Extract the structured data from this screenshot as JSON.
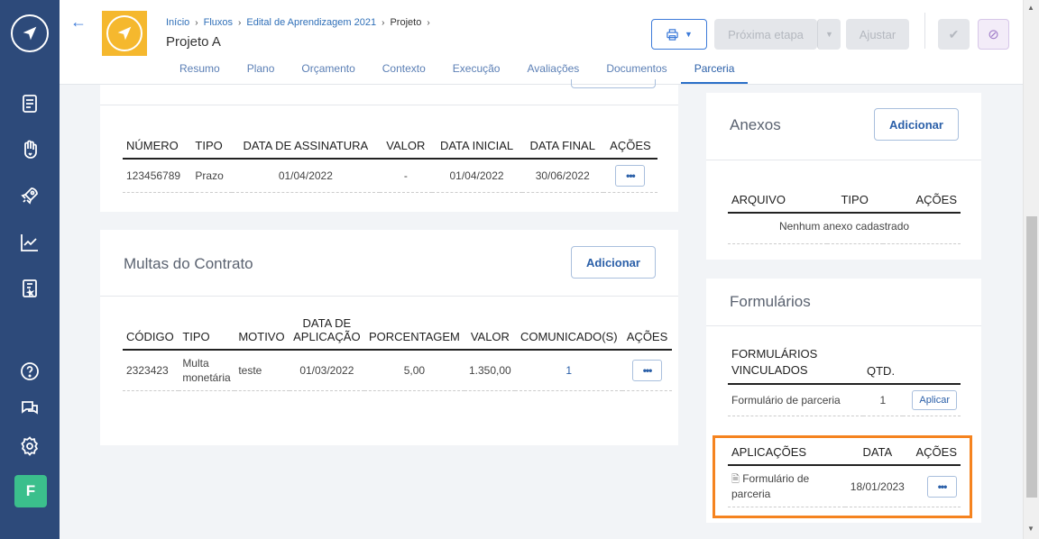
{
  "header": {
    "breadcrumb": [
      "Início",
      "Fluxos",
      "Edital de Aprendizagem 2021",
      "Projeto"
    ],
    "title": "Projeto A",
    "buttons": {
      "next": "Próxima etapa",
      "adjust": "Ajustar"
    }
  },
  "tabs": [
    "Resumo",
    "Plano",
    "Orçamento",
    "Contexto",
    "Execução",
    "Avaliações",
    "Documentos",
    "Parceria"
  ],
  "active_tab": "Parceria",
  "contract_table": {
    "columns": [
      "NÚMERO",
      "TIPO",
      "DATA DE ASSINATURA",
      "VALOR",
      "DATA INICIAL",
      "DATA FINAL",
      "AÇÕES"
    ],
    "rows": [
      [
        "123456789",
        "Prazo",
        "01/04/2022",
        "-",
        "01/04/2022",
        "30/06/2022"
      ]
    ]
  },
  "multas": {
    "title": "Multas do Contrato",
    "add_label": "Adicionar",
    "columns": [
      "CÓDIGO",
      "TIPO",
      "MOTIVO",
      "DATA DE APLICAÇÃO",
      "PORCENTAGEM",
      "VALOR",
      "COMUNICADO(S)",
      "AÇÕES"
    ],
    "rows": [
      [
        "2323423",
        "Multa monetária",
        "teste",
        "01/03/2022",
        "5,00",
        "1.350,00",
        "1"
      ]
    ]
  },
  "anexos": {
    "title": "Anexos",
    "add_label": "Adicionar",
    "columns": [
      "ARQUIVO",
      "TIPO",
      "AÇÕES"
    ],
    "empty": "Nenhum anexo cadastrado"
  },
  "formularios": {
    "title": "Formulários",
    "columns": [
      "FORMULÁRIOS VINCULADOS",
      "QTD."
    ],
    "rows": [
      [
        "Formulário de parceria",
        "1",
        "Aplicar"
      ]
    ],
    "apps_columns": [
      "APLICAÇÕES",
      "DATA",
      "AÇÕES"
    ],
    "apps_rows": [
      [
        "Formulário de parceria",
        "18/01/2023"
      ]
    ]
  },
  "sidebar": {
    "icons": [
      "document-icon",
      "hand-heart-icon",
      "rocket-icon",
      "chart-icon",
      "book-icon",
      "help-icon",
      "chat-icon",
      "settings-icon"
    ],
    "avatar": "F"
  },
  "colors": {
    "sidebar": "#2d4a7a",
    "accent": "#2a5fa8",
    "highlight": "#f5831f",
    "avatar": "#3bbf8c",
    "logo": "#f5b82e"
  }
}
